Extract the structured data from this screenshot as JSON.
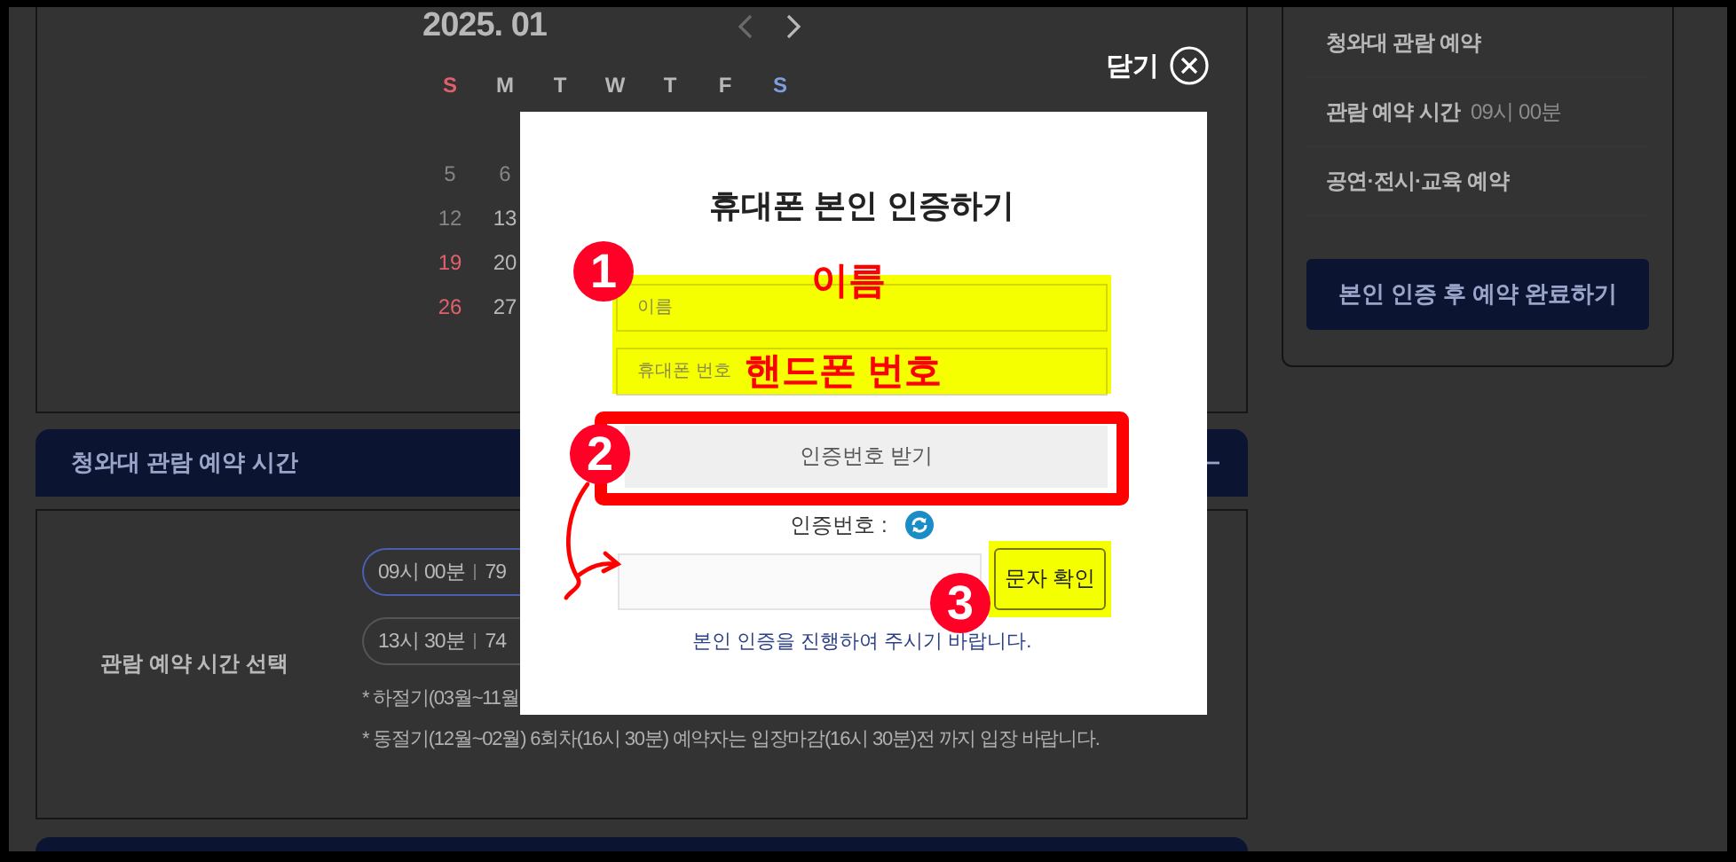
{
  "calendar": {
    "month": "2025. 01",
    "nav": [
      {
        "kind": "prev",
        "disabled": true
      },
      {
        "kind": "next",
        "disabled": false
      }
    ],
    "weekdays": [
      {
        "label": "S",
        "kind": "sunday"
      },
      {
        "label": "M",
        "kind": "weekday"
      },
      {
        "label": "T",
        "kind": "weekday"
      },
      {
        "label": "W",
        "kind": "weekday"
      },
      {
        "label": "T",
        "kind": "weekday"
      },
      {
        "label": "F",
        "kind": "weekday"
      },
      {
        "label": "S",
        "kind": "saturday"
      }
    ],
    "weeks": [
      [
        {
          "day": "5",
          "kind": "sunday",
          "disabled": true
        },
        {
          "day": "6",
          "kind": "weekday",
          "disabled": true
        }
      ],
      [
        {
          "day": "12",
          "kind": "sunday",
          "disabled": true
        },
        {
          "day": "13",
          "kind": "weekday",
          "disabled": false
        }
      ],
      [
        {
          "day": "19",
          "kind": "sunday",
          "disabled": false
        },
        {
          "day": "20",
          "kind": "weekday",
          "disabled": false
        }
      ],
      [
        {
          "day": "26",
          "kind": "sunday",
          "disabled": false
        },
        {
          "day": "27",
          "kind": "weekday",
          "disabled": false
        }
      ]
    ]
  },
  "time_section": {
    "title": "청와대 관람 예약 시간",
    "label": "관람 예약 시간 선택",
    "slots": [
      {
        "time": "09시 00분",
        "count": "79",
        "selected": true
      },
      {
        "time": "13시 30분",
        "count": "74",
        "selected": false
      }
    ],
    "notes": [
      "* 하절기(03월~11월",
      "* 동절기(12월~02월) 6회차(16시 30분) 예약자는 입장마감(16시 30분)전 까지 입장 바랍니다."
    ]
  },
  "summary": {
    "items": [
      {
        "label": "청와대 관람 예약"
      },
      {
        "label": "관람 예약 시간",
        "value": "09시 00분"
      },
      {
        "label": "공연·전시·교육 예약"
      }
    ],
    "submit": "본인 인증 후 예약 완료하기"
  },
  "modal": {
    "close": "닫기",
    "title": "휴대폰 본인 인증하기",
    "fields": [
      {
        "placeholder": "이름"
      },
      {
        "placeholder": "휴대폰 번호"
      }
    ],
    "request_button": "인증번호 받기",
    "code_label": "인증번호 :",
    "confirm_button": "문자 확인",
    "notice": "본인 인증을 진행하여 주시기 바랍니다."
  },
  "annotations": {
    "markers": [
      "1",
      "2",
      "3"
    ],
    "labels": [
      "이름",
      "핸드폰 번호"
    ]
  }
}
